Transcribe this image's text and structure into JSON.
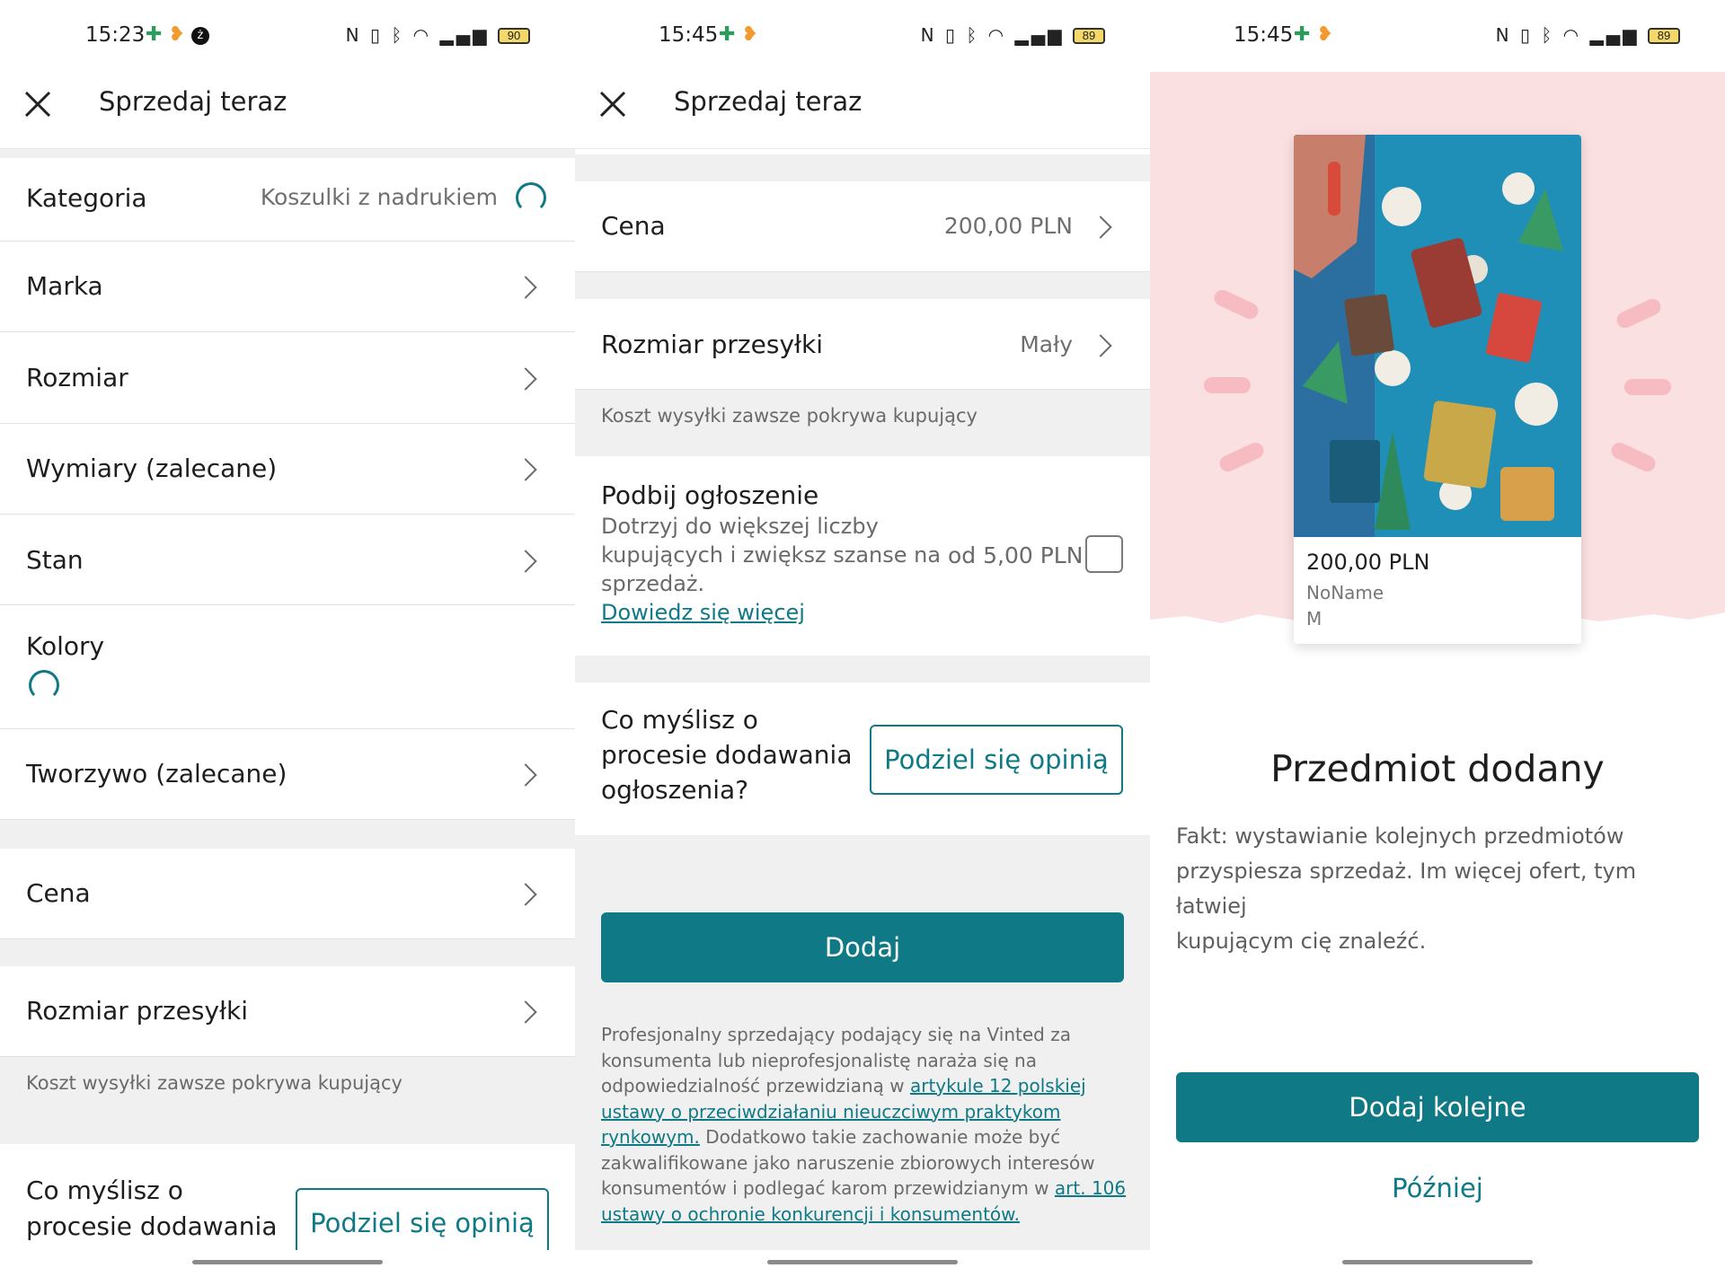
{
  "colors": {
    "accent": "#0f7a86",
    "pink_bg": "#fbe0e2",
    "section_gray": "#f0f0f0"
  },
  "screen1": {
    "status": {
      "time": "15:23",
      "battery": "90"
    },
    "header": {
      "title": "Sprzedaj teraz",
      "close_icon": "close-icon"
    },
    "rows": {
      "category": {
        "label": "Kategoria",
        "value": "Koszulki z nadrukiem"
      },
      "brand": {
        "label": "Marka"
      },
      "size": {
        "label": "Rozmiar"
      },
      "dimensions": {
        "label": "Wymiary (zalecane)"
      },
      "condition": {
        "label": "Stan"
      },
      "colors": {
        "label": "Kolory"
      },
      "material": {
        "label": "Tworzywo (zalecane)"
      },
      "price": {
        "label": "Cena"
      },
      "parcel": {
        "label": "Rozmiar przesyłki"
      }
    },
    "shipping_note": "Koszt wysyłki zawsze pokrywa kupujący",
    "feedback": {
      "line1": "Co myślisz o",
      "line2": "procesie dodawania",
      "button": "Podziel się opinią"
    }
  },
  "screen2": {
    "status": {
      "time": "15:45",
      "battery": "89"
    },
    "header": {
      "title": "Sprzedaj teraz"
    },
    "price": {
      "label": "Cena",
      "value": "200,00 PLN"
    },
    "parcel": {
      "label": "Rozmiar przesyłki",
      "value": "Mały"
    },
    "shipping_note": "Koszt wysyłki zawsze pokrywa kupujący",
    "boost": {
      "title": "Podbij ogłoszenie",
      "line1": "Dotrzyj do większej liczby",
      "line2": "kupujących i zwiększ szanse na",
      "line3": "sprzedaż.",
      "link": "Dowiedz się więcej",
      "price": "od 5,00 PLN"
    },
    "feedback": {
      "line1": "Co myślisz o",
      "line2": "procesie dodawania",
      "line3": "ogłoszenia?",
      "button": "Podziel się opinią"
    },
    "add_button": "Dodaj",
    "legal": {
      "l1": "Profesjonalny sprzedający podający się na Vinted za",
      "l2": "konsumenta lub nieprofesjonalistę naraża się na",
      "l3a": "odpowiedzialność przewidzianą w ",
      "l3link": "artykule 12 polskiej",
      "l4link": "ustawy o przeciwdziałaniu nieuczciwym praktykom",
      "l5link": "rynkowym.",
      "l5b": " Dodatkowo takie zachowanie może być",
      "l6": "zakwalifikowane jako naruszenie zbiorowych interesów",
      "l7a": "konsumentów i podlegać karom przewidzianym w ",
      "l7link": "art. 106",
      "l8link": "ustawy o ochronie konkurencji i konsumentów."
    }
  },
  "screen3": {
    "status": {
      "time": "15:45",
      "battery": "89"
    },
    "card": {
      "price": "200,00 PLN",
      "brand": "NoName",
      "size": "M"
    },
    "title": "Przedmiot dodany",
    "fact": {
      "l1": "Fakt: wystawianie kolejnych przedmiotów",
      "l2": "przyspiesza sprzedaż. Im więcej ofert, tym łatwiej",
      "l3": "kupującym cię znaleźć."
    },
    "add_more_button": "Dodaj kolejne",
    "later_link": "Później"
  }
}
